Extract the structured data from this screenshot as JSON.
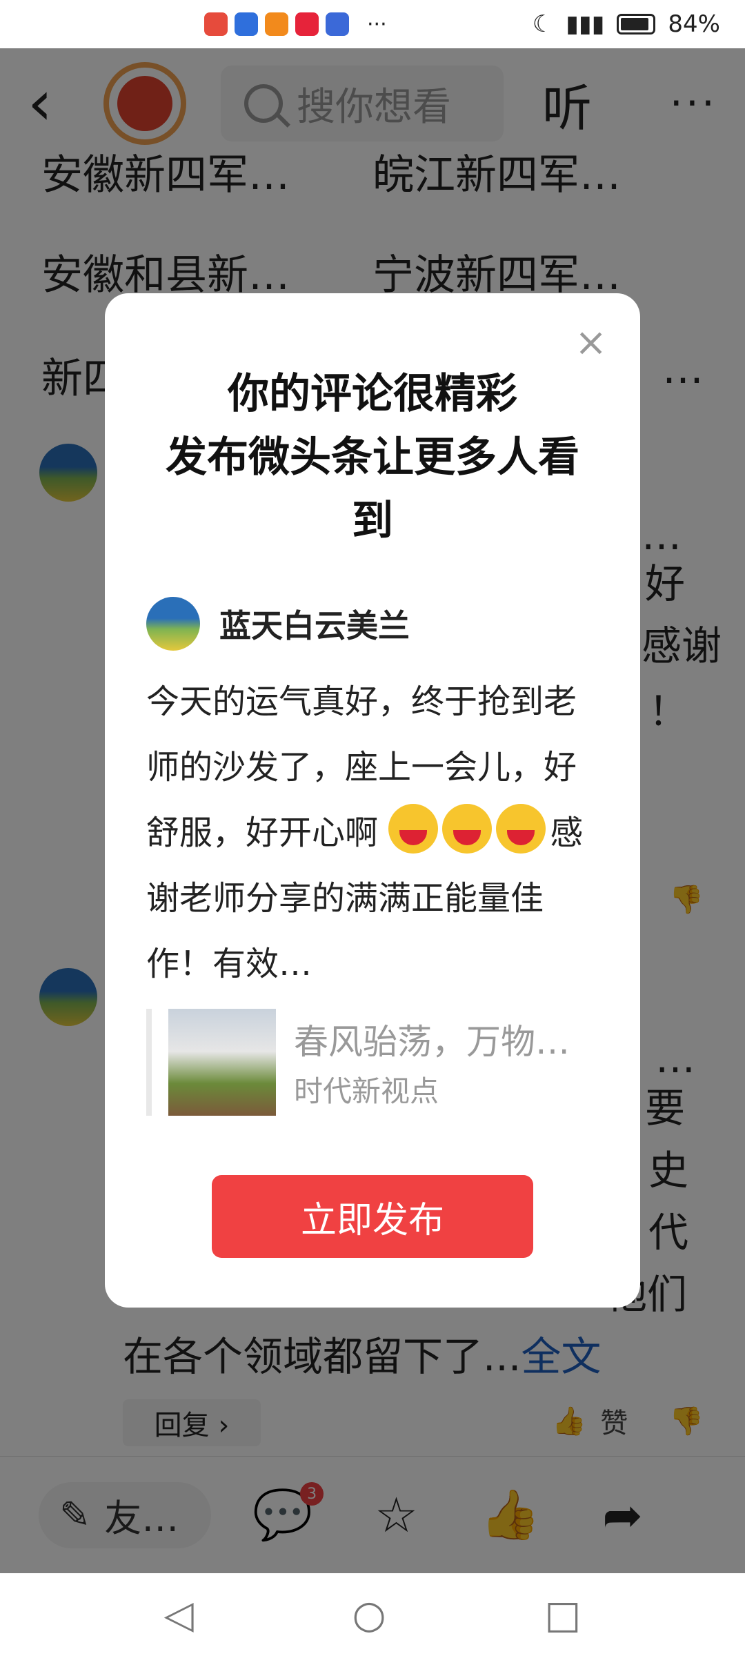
{
  "status": {
    "battery": "84%",
    "more": "···"
  },
  "header": {
    "search_placeholder": "搜你想看",
    "listen": "听",
    "more": "···",
    "back": "‹"
  },
  "suggestions": [
    [
      "安徽新四军…",
      "皖江新四军…"
    ],
    [
      "安徽和县新…",
      "宁波新四军…"
    ],
    [
      "新四…",
      "…"
    ]
  ],
  "background": {
    "comment1_tail": [
      "…",
      "好",
      "感谢",
      "！"
    ],
    "comment2_tail": [
      "…",
      "要",
      "史",
      "代",
      "他们"
    ],
    "comment2_last": "在各个领域都留下了...",
    "full_text_link": "全文",
    "reply": "回复 ›",
    "like": "赞"
  },
  "bottom": {
    "write_label": "友…",
    "comment_badge": "3"
  },
  "modal": {
    "title": "你的评论很精彩\n发布微头条让更多人看\n到",
    "author": "蓝天白云美兰",
    "body_1": "今天的运气真好，终于抢到老师的沙发了，座上一会儿，好舒服，好开心啊",
    "body_2": "感谢老师分享的满满正能量佳作！有效…",
    "quote_title": "春风骀荡，万物…",
    "quote_source": "时代新视点",
    "publish_button": "立即发布",
    "close": "×"
  }
}
